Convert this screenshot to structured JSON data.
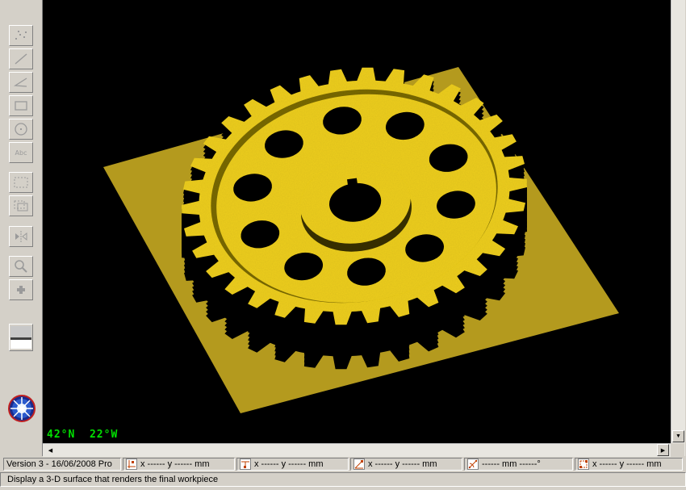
{
  "toolbar": {
    "text_tool_label": "Abc"
  },
  "viewport": {
    "coordinates": "42°N  22°W",
    "background": "#000000",
    "part_color": "#f0d020",
    "base_plate_color": "#b49a1e"
  },
  "statusbar": {
    "version": "Version 3 - 16/06/2008  Pro",
    "fields": [
      {
        "icon": "point-icon",
        "text": "x ------   y ------  mm"
      },
      {
        "icon": "line-start-icon",
        "text": "x ------   y ------  mm"
      },
      {
        "icon": "angle-icon",
        "text": "x ------   y ------  mm"
      },
      {
        "icon": "distance-angle-icon",
        "text": "------ mm   ------°"
      },
      {
        "icon": "rect-corner-icon",
        "text": "x ------   y ------  mm"
      }
    ]
  },
  "hint": "Display a 3-D surface that renders the final workpiece"
}
